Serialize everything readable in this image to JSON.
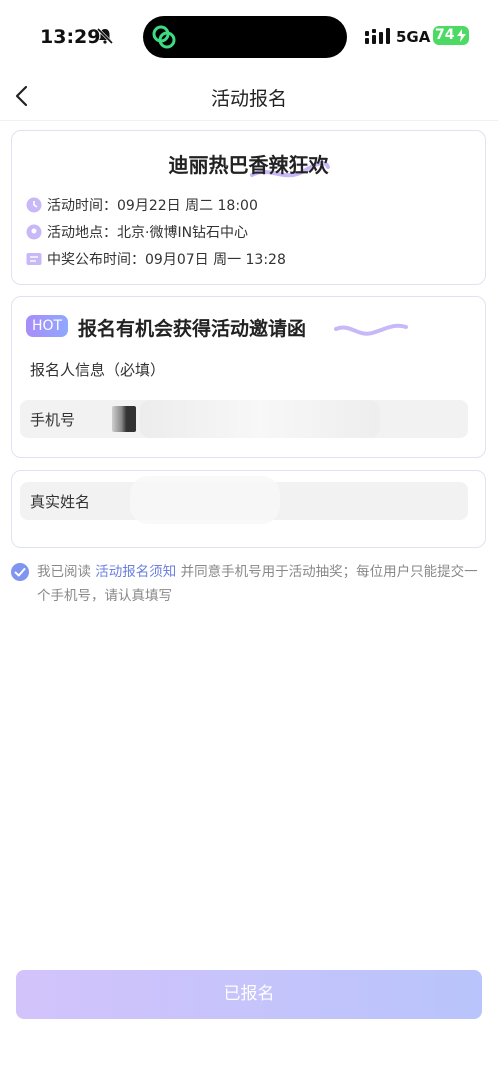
{
  "status_bar": {
    "time": "13:29",
    "network": "5GA",
    "battery": "74",
    "icons": [
      "bell-slash-icon",
      "app-link-icon",
      "signal-icon",
      "charging-icon"
    ]
  },
  "nav": {
    "title": "活动报名",
    "back_icon": "chevron-left-icon"
  },
  "event": {
    "title": "迪丽热巴香辣狂欢",
    "time_label": "活动时间：09月22日 周二 18:00",
    "place_label": "活动地点：北京·微博IN钻石中心",
    "announce_label": "中奖公布时间：09月07日 周一 13:28"
  },
  "signup": {
    "badge": "HOT",
    "promo": "报名有机会获得活动邀请函",
    "section_label": "报名人信息（必填）",
    "phone_label": "手机号",
    "name_label": "真实姓名"
  },
  "agreement": {
    "checked": true,
    "prefix": "我已阅读 ",
    "link": "活动报名须知",
    "suffix": " 并同意手机号用于活动抽奖；每位用户只能提交一个手机号，请认真填写"
  },
  "submit": {
    "label": "已报名"
  },
  "colors": {
    "accent": "#7f95f0",
    "link": "#6b7fe0",
    "button_start": "#d3c3fb",
    "button_end": "#b8c4fb",
    "battery": "#4cd964"
  }
}
